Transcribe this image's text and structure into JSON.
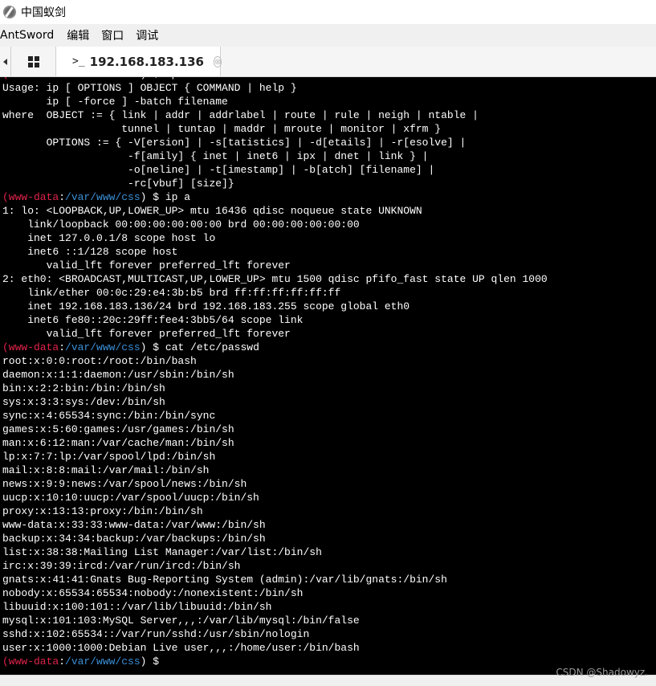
{
  "window": {
    "title": "中国蚁剑",
    "icon": "antsword-logo-icon"
  },
  "menubar": {
    "items": [
      "AntSword",
      "编辑",
      "窗口",
      "调试"
    ]
  },
  "tabs": {
    "home_icon": "grid-icon",
    "terminal_tab": {
      "prompt": ">_",
      "label": "192.168.183.136",
      "close": "⊗"
    }
  },
  "terminal": {
    "prompt_user": "www-data",
    "prompt_path": "/var/www/css",
    "colors": {
      "user": "#e0234a",
      "path": "#3a8fd6",
      "background": "#000000"
    },
    "lines": [
      {
        "type": "prompt",
        "user": "(www-data",
        "sep": ":",
        "path": "/var/www/css",
        "rest": ") $ ip"
      },
      {
        "type": "text",
        "text": "Usage: ip [ OPTIONS ] OBJECT { COMMAND | help }"
      },
      {
        "type": "text",
        "text": "       ip [ -force ] -batch filename"
      },
      {
        "type": "text",
        "text": "where  OBJECT := { link | addr | addrlabel | route | rule | neigh | ntable |"
      },
      {
        "type": "text",
        "text": "                   tunnel | tuntap | maddr | mroute | monitor | xfrm }"
      },
      {
        "type": "text",
        "text": "       OPTIONS := { -V[ersion] | -s[tatistics] | -d[etails] | -r[esolve] |"
      },
      {
        "type": "text",
        "text": "                    -f[amily] { inet | inet6 | ipx | dnet | link } |"
      },
      {
        "type": "text",
        "text": "                    -o[neline] | -t[imestamp] | -b[atch] [filename] |"
      },
      {
        "type": "text",
        "text": "                    -rc[vbuf] [size]}"
      },
      {
        "type": "prompt",
        "user": "(www-data",
        "sep": ":",
        "path": "/var/www/css",
        "rest": ") $ ip a"
      },
      {
        "type": "text",
        "text": "1: lo: <LOOPBACK,UP,LOWER_UP> mtu 16436 qdisc noqueue state UNKNOWN"
      },
      {
        "type": "text",
        "text": "    link/loopback 00:00:00:00:00:00 brd 00:00:00:00:00:00"
      },
      {
        "type": "text",
        "text": "    inet 127.0.0.1/8 scope host lo"
      },
      {
        "type": "text",
        "text": "    inet6 ::1/128 scope host"
      },
      {
        "type": "text",
        "text": "       valid_lft forever preferred_lft forever"
      },
      {
        "type": "text",
        "text": "2: eth0: <BROADCAST,MULTICAST,UP,LOWER_UP> mtu 1500 qdisc pfifo_fast state UP qlen 1000"
      },
      {
        "type": "text",
        "text": "    link/ether 00:0c:29:e4:3b:b5 brd ff:ff:ff:ff:ff:ff"
      },
      {
        "type": "text",
        "text": "    inet 192.168.183.136/24 brd 192.168.183.255 scope global eth0"
      },
      {
        "type": "text",
        "text": "    inet6 fe80::20c:29ff:fee4:3bb5/64 scope link"
      },
      {
        "type": "text",
        "text": "       valid_lft forever preferred_lft forever"
      },
      {
        "type": "prompt",
        "user": "(www-data",
        "sep": ":",
        "path": "/var/www/css",
        "rest": ") $ cat /etc/passwd"
      },
      {
        "type": "text",
        "text": "root:x:0:0:root:/root:/bin/bash"
      },
      {
        "type": "text",
        "text": "daemon:x:1:1:daemon:/usr/sbin:/bin/sh"
      },
      {
        "type": "text",
        "text": "bin:x:2:2:bin:/bin:/bin/sh"
      },
      {
        "type": "text",
        "text": "sys:x:3:3:sys:/dev:/bin/sh"
      },
      {
        "type": "text",
        "text": "sync:x:4:65534:sync:/bin:/bin/sync"
      },
      {
        "type": "text",
        "text": "games:x:5:60:games:/usr/games:/bin/sh"
      },
      {
        "type": "text",
        "text": "man:x:6:12:man:/var/cache/man:/bin/sh"
      },
      {
        "type": "text",
        "text": "lp:x:7:7:lp:/var/spool/lpd:/bin/sh"
      },
      {
        "type": "text",
        "text": "mail:x:8:8:mail:/var/mail:/bin/sh"
      },
      {
        "type": "text",
        "text": "news:x:9:9:news:/var/spool/news:/bin/sh"
      },
      {
        "type": "text",
        "text": "uucp:x:10:10:uucp:/var/spool/uucp:/bin/sh"
      },
      {
        "type": "text",
        "text": "proxy:x:13:13:proxy:/bin:/bin/sh"
      },
      {
        "type": "text",
        "text": "www-data:x:33:33:www-data:/var/www:/bin/sh"
      },
      {
        "type": "text",
        "text": "backup:x:34:34:backup:/var/backups:/bin/sh"
      },
      {
        "type": "text",
        "text": "list:x:38:38:Mailing List Manager:/var/list:/bin/sh"
      },
      {
        "type": "text",
        "text": "irc:x:39:39:ircd:/var/run/ircd:/bin/sh"
      },
      {
        "type": "text",
        "text": "gnats:x:41:41:Gnats Bug-Reporting System (admin):/var/lib/gnats:/bin/sh"
      },
      {
        "type": "text",
        "text": "nobody:x:65534:65534:nobody:/nonexistent:/bin/sh"
      },
      {
        "type": "text",
        "text": "libuuid:x:100:101::/var/lib/libuuid:/bin/sh"
      },
      {
        "type": "text",
        "text": "mysql:x:101:103:MySQL Server,,,:/var/lib/mysql:/bin/false"
      },
      {
        "type": "text",
        "text": "sshd:x:102:65534::/var/run/sshd:/usr/sbin/nologin"
      },
      {
        "type": "text",
        "text": "user:x:1000:1000:Debian Live user,,,:/home/user:/bin/bash"
      },
      {
        "type": "prompt",
        "user": "(www-data",
        "sep": ":",
        "path": "/var/www/css",
        "rest": ") $ "
      }
    ]
  },
  "watermark": "CSDN @Shadowyz."
}
